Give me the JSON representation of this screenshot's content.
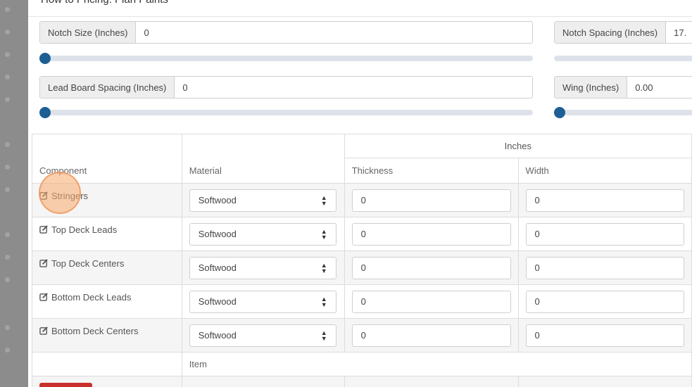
{
  "panel": {
    "title": "How to Pricing: Plan Paints"
  },
  "fields": {
    "notch_size": {
      "label": "Notch Size (Inches)",
      "value": "0"
    },
    "notch_spacing": {
      "label": "Notch Spacing (Inches)",
      "value": "17."
    },
    "lead_board_spacing": {
      "label": "Lead Board Spacing (Inches)",
      "value": "0"
    },
    "wing": {
      "label": "Wing (Inches)",
      "value": "0.00"
    }
  },
  "sliders": {
    "notch_size": 0,
    "notch_spacing": 0,
    "lead_board_spacing": 0,
    "wing": 0
  },
  "table": {
    "group_header": "Inches",
    "headers": {
      "component": "Component",
      "material": "Material",
      "thickness": "Thickness",
      "width": "Width"
    },
    "rows": [
      {
        "component": "Stringers",
        "material": "Softwood",
        "thickness": "0",
        "width": "0"
      },
      {
        "component": "Top Deck Leads",
        "material": "Softwood",
        "thickness": "0",
        "width": "0"
      },
      {
        "component": "Top Deck Centers",
        "material": "Softwood",
        "thickness": "0",
        "width": "0"
      },
      {
        "component": "Bottom Deck Leads",
        "material": "Softwood",
        "thickness": "0",
        "width": "0"
      },
      {
        "component": "Bottom Deck Centers",
        "material": "Softwood",
        "thickness": "0",
        "width": "0"
      }
    ],
    "item_header": "Item"
  },
  "colors": {
    "accent": "#1d5f95",
    "danger": "#c9302c",
    "highlight": "#f7aa6e"
  },
  "icons": {
    "edit": "edit-icon",
    "select_arrows": "sort-arrows-icon"
  }
}
